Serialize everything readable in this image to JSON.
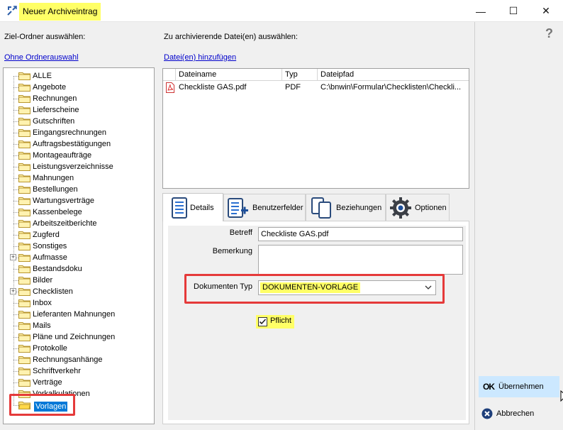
{
  "window": {
    "title": "Neuer Archiveintrag",
    "minimize_glyph": "—",
    "maximize_glyph": "☐",
    "close_glyph": "✕"
  },
  "left": {
    "heading": "Ziel-Ordner auswählen:",
    "no_folder_link": "Ohne Ordnerauswahl",
    "folders": [
      {
        "label": "ALLE",
        "expandable": false
      },
      {
        "label": "Angebote",
        "expandable": false
      },
      {
        "label": "Rechnungen",
        "expandable": false
      },
      {
        "label": "Lieferscheine",
        "expandable": false
      },
      {
        "label": "Gutschriften",
        "expandable": false
      },
      {
        "label": "Eingangsrechnungen",
        "expandable": false
      },
      {
        "label": "Auftragsbestätigungen",
        "expandable": false
      },
      {
        "label": "Montageaufträge",
        "expandable": false
      },
      {
        "label": "Leistungsverzeichnisse",
        "expandable": false
      },
      {
        "label": "Mahnungen",
        "expandable": false
      },
      {
        "label": "Bestellungen",
        "expandable": false
      },
      {
        "label": "Wartungsverträge",
        "expandable": false
      },
      {
        "label": "Kassenbelege",
        "expandable": false
      },
      {
        "label": "Arbeitszeitberichte",
        "expandable": false
      },
      {
        "label": "Zugferd",
        "expandable": false
      },
      {
        "label": "Sonstiges",
        "expandable": false
      },
      {
        "label": "Aufmasse",
        "expandable": true
      },
      {
        "label": "Bestandsdoku",
        "expandable": false
      },
      {
        "label": "Bilder",
        "expandable": false
      },
      {
        "label": "Checklisten",
        "expandable": true
      },
      {
        "label": "Inbox",
        "expandable": false
      },
      {
        "label": "Lieferanten Mahnungen",
        "expandable": false
      },
      {
        "label": "Mails",
        "expandable": false
      },
      {
        "label": "Pläne und Zeichnungen",
        "expandable": false
      },
      {
        "label": "Protokolle",
        "expandable": false
      },
      {
        "label": "Rechnungsanhänge",
        "expandable": false
      },
      {
        "label": "Schriftverkehr",
        "expandable": false
      },
      {
        "label": "Verträge",
        "expandable": false
      },
      {
        "label": "Vorkalkulationen",
        "expandable": false
      },
      {
        "label": "Vorlagen",
        "expandable": false,
        "selected": true
      }
    ]
  },
  "files": {
    "heading": "Zu archivierende Datei(en) auswählen:",
    "add_link": "Datei(en) hinzufügen",
    "columns": [
      "Dateiname",
      "Typ",
      "Dateipfad"
    ],
    "rows": [
      {
        "name": "Checkliste GAS.pdf",
        "type": "PDF",
        "path": "C:\\bnwin\\Formular\\Checklisten\\Checkli..."
      }
    ]
  },
  "tabs": [
    {
      "label": "Details",
      "icon": "details-icon",
      "active": true
    },
    {
      "label": "Benutzerfelder",
      "icon": "user-fields-icon",
      "active": false
    },
    {
      "label": "Beziehungen",
      "icon": "relations-icon",
      "active": false
    },
    {
      "label": "Optionen",
      "icon": "options-gear-icon",
      "active": false
    }
  ],
  "details": {
    "betreff_label": "Betreff",
    "betreff_value": "Checkliste GAS.pdf",
    "bemerkung_label": "Bemerkung",
    "bemerkung_value": "",
    "doktyp_label": "Dokumenten Typ",
    "doktyp_value": "DOKUMENTEN-VORLAGE",
    "pflicht_label": "Pflicht",
    "pflicht_checked": true
  },
  "side": {
    "help_glyph": "?",
    "ok_label": "Übernehmen",
    "cancel_label": "Abbrechen"
  },
  "colors": {
    "highlight_yellow": "#ffff66",
    "annotation_red": "#e53a3a",
    "link_blue": "#0000cc",
    "selection_blue": "#0078d7",
    "hover_blue": "#cce8ff"
  }
}
